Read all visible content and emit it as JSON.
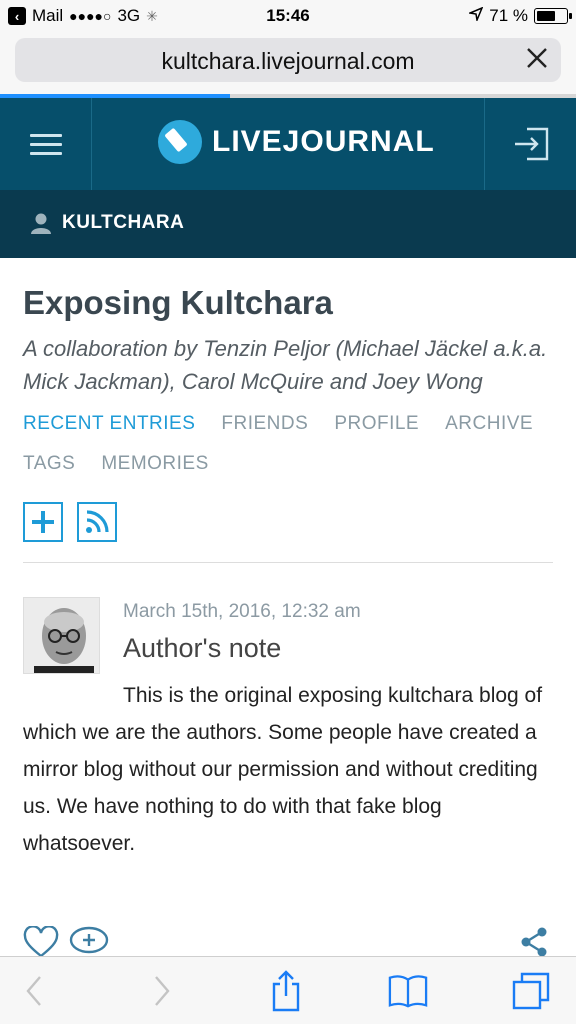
{
  "status_bar": {
    "carrier": "Mail",
    "signal_dots": "●●●●○",
    "network": "3G",
    "time": "15:46",
    "battery_percent": "71 %",
    "battery_level": 0.71
  },
  "browser": {
    "url": "kultchara.livejournal.com",
    "load_progress": 0.4
  },
  "header": {
    "logo_text": "LIVEJOURNAL"
  },
  "journal": {
    "username": "KULTCHARA",
    "title": "Exposing Kultchara",
    "subtitle": "A collaboration by Tenzin Peljor (Michael Jäckel a.k.a. Mick Jackman), Carol McQuire and Joey Wong"
  },
  "nav": {
    "items": [
      "RECENT ENTRIES",
      "FRIENDS",
      "PROFILE",
      "ARCHIVE",
      "TAGS",
      "MEMORIES"
    ],
    "active": "RECENT ENTRIES"
  },
  "entry": {
    "date": "March 15th, 2016, 12:32 am",
    "title": "Author's note",
    "body": "This is the original exposing kultchara blog of which we are the authors. Some people have created a mirror blog without our permission and without crediting us. We have nothing to do with that fake blog whatsoever."
  },
  "colors": {
    "header_bg": "#064f6b",
    "journal_bar_bg": "#0a3a4f",
    "accent": "#1e9bd7",
    "nav_inactive": "#8a9aa3"
  }
}
